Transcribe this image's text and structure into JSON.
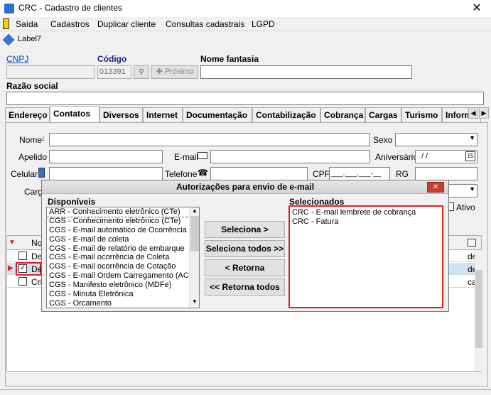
{
  "window": {
    "title": "CRC - Cadastro de clientes",
    "close_glyph": "✕"
  },
  "menu": [
    "Saída",
    "Cadastros",
    "Duplicar cliente",
    "Consultas cadastrais",
    "LGPD"
  ],
  "toolbar": {
    "label": "Label7"
  },
  "header": {
    "cnpj_label": "CNPJ",
    "codigo_label": "Código",
    "codigo_value": "013391",
    "proximo_label": "Próximo",
    "nome_fantasia_label": "Nome fantasia",
    "razao_social_label": "Razão social"
  },
  "tabs": [
    "Endereço",
    "Contatos",
    "Diversos",
    "Internet",
    "Documentação",
    "Contabilização",
    "Cobrança",
    "Cargas",
    "Turismo",
    "Inform"
  ],
  "active_tab": "Contatos",
  "form": {
    "nome": "Nome",
    "sexo": "Sexo",
    "apelido": "Apelido",
    "email": "E-mail",
    "aniversario": "Aniversário",
    "aniversario_value": "/  /",
    "celular": "Celular",
    "telefone": "Telefone",
    "cpf": "CPF",
    "cpf_mask": "___.___.___-__",
    "rg": "RG",
    "cargo": "Carg",
    "ativo": "Ativo"
  },
  "grid": {
    "col_no": "No",
    "rows": [
      {
        "text": "De",
        "checked": false,
        "right": "de"
      },
      {
        "text": "De",
        "checked": true,
        "right": "de"
      },
      {
        "text": "Cri",
        "checked": false,
        "right": "ca"
      }
    ]
  },
  "dialog": {
    "title": "Autorizações para envio de e-mail",
    "close_glyph": "✕",
    "disponiveis_label": "Disponíveis",
    "selecionados_label": "Selecionados",
    "disponiveis": [
      "ARR - Conhecimento eletrônico (CTe)",
      "CGS - Conhecimento eletrônico (CTe)",
      "CGS - E-mail automático de Ocorrência",
      "CGS - E-mail de coleta",
      "CGS - E-mail de relatório de embarque",
      "CGS - E-mail ocorrência de Coleta",
      "CGS - E-mail ocorrência de Cotação",
      "CGS - E-mail Ordem Carregamento (ACT)",
      "CGS - Manifesto eletrônico (MDFe)",
      "CGS - Minuta Eletrônica",
      "CGS - Orcamento"
    ],
    "selecionados": [
      "CRC - E-mail lembrete de cobrança",
      "CRC - Fatura"
    ],
    "buttons": {
      "seleciona": "Seleciona >",
      "seleciona_todos": "Seleciona todos >>",
      "retorna": "< Retorna",
      "retorna_todos": "<< Retorna todos"
    }
  }
}
